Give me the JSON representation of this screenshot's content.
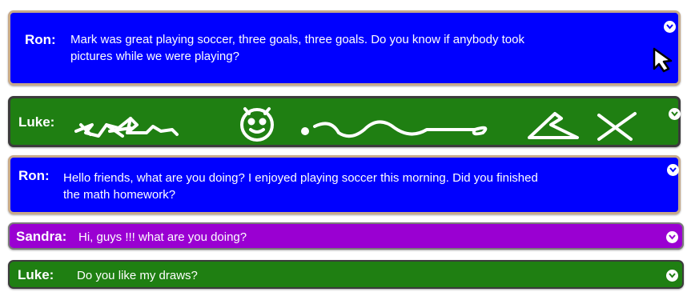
{
  "messages": [
    {
      "sender": "Ron:",
      "text_line1": "Mark was great playing soccer, three goals, three goals. Do you know if anybody took",
      "text_line2": "pictures  while we were playing?",
      "color": "#0000ff"
    },
    {
      "sender": "Luke:",
      "content": "drawing",
      "color": "#1f7f12"
    },
    {
      "sender": "Ron:",
      "text_line1": "Hello friends, what are you doing? I enjoyed playing soccer this morning. Did you finished",
      "text_line2": "the math homework?",
      "color": "#0000ff"
    },
    {
      "sender": "Sandra:",
      "text": "Hi, guys !!!  what are you doing?",
      "color": "#9a00d2"
    },
    {
      "sender": "Luke:",
      "text": "Do you like my draws?",
      "color": "#1f7f12"
    }
  ],
  "icons": {
    "expand": "chevron-down-icon",
    "cursor": "cursor-arrow-icon"
  }
}
